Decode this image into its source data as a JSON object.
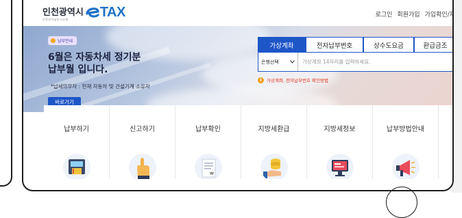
{
  "header": {
    "logo_text": "인천광역시",
    "logo_subtext": "인천과거납부시스템",
    "logo_brand": "TAX",
    "links": [
      "로그인",
      "회원가입",
      "가입확인/재"
    ]
  },
  "hero": {
    "badge": "납부안내",
    "title_line1": "6월은 자동차세 정기분",
    "title_line2": "납부월 입니다.",
    "subtitle": "*납세의무자 : 현재 자동차 및 건설기계 소유자",
    "button": "바로가기"
  },
  "payment": {
    "tabs": [
      {
        "label": "가상계좌",
        "active": true
      },
      {
        "label": "전자납부번호",
        "active": false
      },
      {
        "label": "상수도요금",
        "active": false
      },
      {
        "label": "환급금조",
        "active": false
      }
    ],
    "bank_select": "은행선택",
    "account_placeholder": "가상계좌 14자리를 입력하세요.",
    "help_text": "가상계좌, 전자납부번호 확인방법"
  },
  "menu": [
    {
      "label": "납부하기",
      "icon": "atm-payment-icon"
    },
    {
      "label": "신고하기",
      "icon": "hand-pointer-icon"
    },
    {
      "label": "납부확인",
      "icon": "document-icon"
    },
    {
      "label": "지방세환급",
      "icon": "coins-hand-icon"
    },
    {
      "label": "지방세정보",
      "icon": "computer-monitor-icon"
    },
    {
      "label": "납부방법안내",
      "icon": "megaphone-icon"
    }
  ],
  "colors": {
    "primary": "#1e56c8",
    "logo_blue": "#1e72c6",
    "warning": "#e0321f"
  }
}
